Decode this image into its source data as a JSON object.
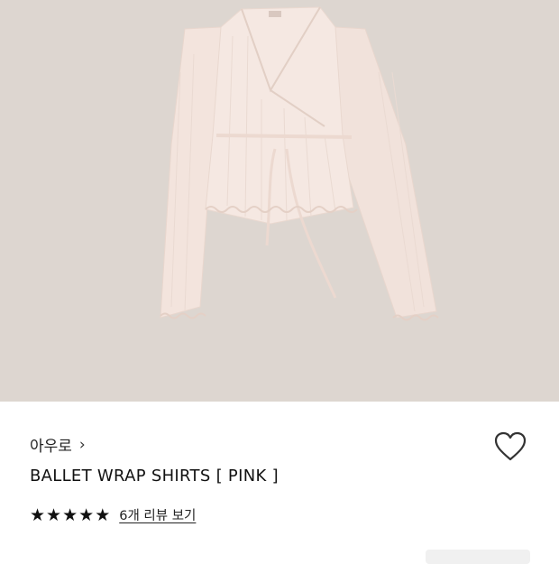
{
  "product": {
    "brand": "아우로",
    "name": "BALLET WRAP SHIRTS [ PINK ]",
    "rating": 5,
    "rating_max": 5,
    "review_link": "6개 리뷰 보기"
  },
  "icons": {
    "brand_chevron": "chevron-right-icon",
    "wishlist": "heart-outline-icon",
    "star": "star-filled-icon"
  },
  "colors": {
    "image_background": "#ddd6d0",
    "garment": "#f3e4dd",
    "text": "#111111"
  }
}
